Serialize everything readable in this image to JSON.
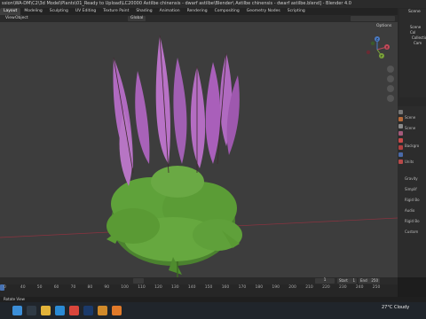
{
  "window": {
    "title": "ssion\\WA-DM\\C2\\3d Model\\Plants\\01_Ready to Upload\\LC20000 Astilbe chinensis - dwarf astilbe\\Blender\\ Astilbe chinensis - dwarf astilbe.blend] - Blender 4.0"
  },
  "workspace_tabs": [
    "Layout",
    "Modeling",
    "Sculpting",
    "UV Editing",
    "Texture Paint",
    "Shading",
    "Animation",
    "Rendering",
    "Compositing",
    "Geometry Nodes",
    "Scripting"
  ],
  "workspace_active": "Layout",
  "viewport_header": {
    "menus": [
      "View",
      "Object"
    ],
    "orientation": "Global",
    "options_label": "Options"
  },
  "gizmo": {
    "x_label": "X",
    "y_label": "Y",
    "z_label": "Z"
  },
  "outliner": {
    "title": "Scene",
    "items": [
      "Scene Col",
      "Collection",
      "Cam"
    ]
  },
  "properties": {
    "rows": [
      "Scene",
      "Scene",
      "Backgro",
      "Units",
      "Gravity",
      "Simplif",
      "Rigid Bo",
      "Audio",
      "Rigid Bo",
      "Custom"
    ]
  },
  "timeline": {
    "current_frame": "1",
    "start_label": "Start",
    "start_value": "1",
    "end_label": "End",
    "end_value": "250",
    "ticks": [
      "0",
      "40",
      "50",
      "60",
      "70",
      "80",
      "90",
      "100",
      "110",
      "120",
      "130",
      "140",
      "150",
      "160",
      "170",
      "180",
      "190",
      "200",
      "210",
      "220",
      "230",
      "240",
      "250"
    ]
  },
  "statusbar": {
    "text": "Rotate View"
  },
  "taskbar": {
    "temperature": "27°C",
    "weather": "Cloudy",
    "apps": [
      "start",
      "search",
      "explorer",
      "edge",
      "chrome",
      "photoshop",
      "files",
      "blender"
    ]
  },
  "colors": {
    "viewport_bg": "#3d3d3d",
    "flower": "#b06ac0",
    "leaf": "#5f9e3a",
    "x_axis": "#a33a4a",
    "accent": "#4772b3"
  }
}
